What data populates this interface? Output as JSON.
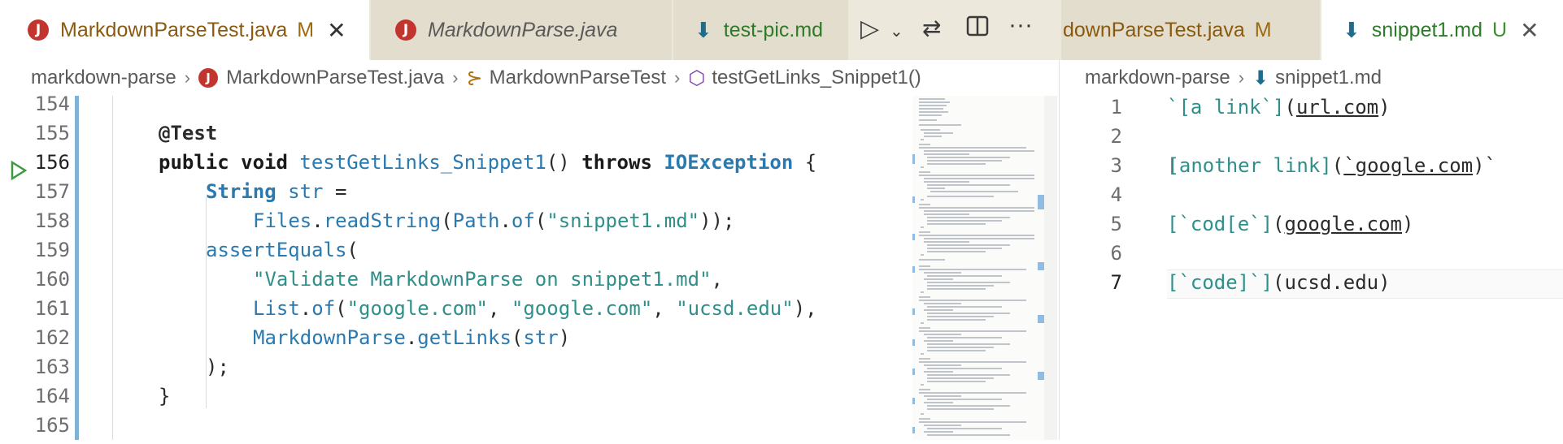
{
  "left_tabs": [
    {
      "label": "MarkdownParseTest.java",
      "modified": "M",
      "icon": "java-icon",
      "active": true
    },
    {
      "label": "MarkdownParse.java",
      "icon": "java-icon",
      "active": false
    },
    {
      "label": "test-pic.md",
      "icon": "markdown-icon",
      "active": false
    }
  ],
  "right_tabs": [
    {
      "label": "downParseTest.java",
      "modified": "M",
      "active": false
    },
    {
      "label": "snippet1.md",
      "modified": "U",
      "icon": "markdown-icon",
      "active": true
    }
  ],
  "left_breadcrumb": [
    "markdown-parse",
    "MarkdownParseTest.java",
    "MarkdownParseTest",
    "testGetLinks_Snippet1()"
  ],
  "right_breadcrumb": [
    "markdown-parse",
    "snippet1.md"
  ],
  "left_editor": {
    "line_numbers": [
      "154",
      "155",
      "156",
      "157",
      "158",
      "159",
      "160",
      "161",
      "162",
      "163",
      "164",
      "165"
    ],
    "annotation": "@Test",
    "sig_public": "public",
    "sig_void": "void",
    "sig_method": "testGetLinks_Snippet1",
    "sig_parens": "()",
    "sig_throws": "throws",
    "sig_exception": "IOException",
    "sig_brace": "{",
    "l157_type": "String",
    "l157_var": "str",
    "l157_eq": "=",
    "l158_files": "Files",
    "l158_read": "readString",
    "l158_path": "Path",
    "l158_of": "of",
    "l158_str": "\"snippet1.md\"",
    "l158_end": "));",
    "l159_fn": "assertEquals",
    "l159_paren": "(",
    "l160_str": "\"Validate MarkdownParse on snippet1.md\"",
    "l161_list": "List",
    "l161_of": "of",
    "l161_s1": "\"google.com\"",
    "l161_s2": "\"google.com\"",
    "l161_s3": "\"ucsd.edu\"",
    "l162_cls": "MarkdownParse",
    "l162_fn": "getLinks",
    "l162_arg": "str",
    "l163": ");",
    "l164": "}"
  },
  "right_editor": {
    "line_numbers": [
      "1",
      "2",
      "3",
      "4",
      "5",
      "6",
      "7"
    ],
    "l1_a": "`[a link`]",
    "l1_b": "url.com",
    "l3_a": "[another link]",
    "l3_b": "`google.com",
    "l3_c": ")`",
    "l5_a": "[`cod[e`]",
    "l5_b": "google.com",
    "l7_a": "[`code]`]",
    "l7_b": "ucsd.edu"
  },
  "colors": {
    "tab_bg": "#ece8dc",
    "accent_modified": "#9a6b12",
    "untracked": "#3c8f2f",
    "string": "#2f8f8a",
    "type": "#2a7ab0"
  }
}
